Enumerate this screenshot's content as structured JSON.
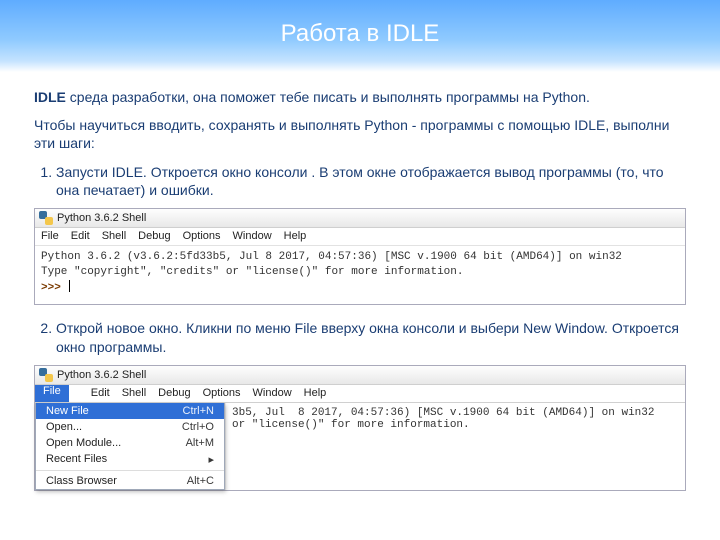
{
  "header": {
    "title": "Работа в IDLE"
  },
  "intro": {
    "bold": "IDLE",
    "p1_rest": " среда разработки, она поможет тебе писать и выполнять программы на Python.",
    "p2": "Чтобы научиться вводить, сохранять и выполнять Python - программы с помощью IDLE, выполни эти шаги:"
  },
  "steps": {
    "s1": "Запусти IDLE. Откроется окно консоли . В этом окне отображается вывод программы (то, что она печатает) и ошибки.",
    "s2": "Открой новое окно. Кликни по меню File вверху окна консоли и выбери New Window. Откроется окно программы."
  },
  "shell": {
    "title": "Python 3.6.2 Shell",
    "menus": {
      "file": "File",
      "edit": "Edit",
      "shell": "Shell",
      "debug": "Debug",
      "options": "Options",
      "window": "Window",
      "help": "Help"
    },
    "line1": "Python 3.6.2 (v3.6.2:5fd33b5, Jul  8 2017, 04:57:36) [MSC v.1900 64 bit (AMD64)] on win32",
    "line2": "Type \"copyright\", \"credits\" or \"license()\" for more information.",
    "prompt": ">>>"
  },
  "fileMenu": {
    "items": [
      {
        "label": "New File",
        "kb": "Ctrl+N",
        "hl": true
      },
      {
        "label": "Open...",
        "kb": "Ctrl+O",
        "hl": false
      },
      {
        "label": "Open Module...",
        "kb": "Alt+M",
        "hl": false
      },
      {
        "label": "Recent Files",
        "kb": "▸",
        "hl": false
      },
      {
        "label": "Class Browser",
        "kb": "Alt+C",
        "hl": false
      }
    ]
  },
  "shell2": {
    "line1_tail": "3b5, Jul  8 2017, 04:57:36) [MSC v.1900 64 bit (AMD64)] on win32",
    "line2_tail": "or \"license()\" for more information."
  }
}
